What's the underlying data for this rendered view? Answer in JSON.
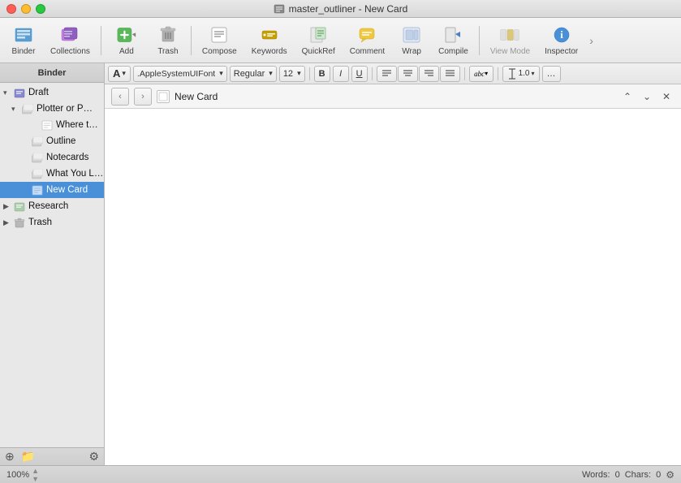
{
  "window": {
    "title": "master_outliner - New Card"
  },
  "titlebar": {
    "buttons": {
      "close": "close",
      "minimize": "minimize",
      "maximize": "maximize"
    }
  },
  "toolbar": {
    "items": [
      {
        "id": "binder",
        "label": "Binder",
        "icon": "binder-icon"
      },
      {
        "id": "collections",
        "label": "Collections",
        "icon": "collections-icon"
      },
      {
        "id": "add",
        "label": "Add",
        "icon": "add-icon",
        "has_arrow": true
      },
      {
        "id": "trash",
        "label": "Trash",
        "icon": "trash-icon"
      },
      {
        "id": "compose",
        "label": "Compose",
        "icon": "compose-icon"
      },
      {
        "id": "keywords",
        "label": "Keywords",
        "icon": "keywords-icon"
      },
      {
        "id": "quickref",
        "label": "QuickRef",
        "icon": "quickref-icon"
      },
      {
        "id": "comment",
        "label": "Comment",
        "icon": "comment-icon"
      },
      {
        "id": "wrap",
        "label": "Wrap",
        "icon": "wrap-icon"
      },
      {
        "id": "compile",
        "label": "Compile",
        "icon": "compile-icon"
      },
      {
        "id": "viewmode",
        "label": "View Mode",
        "icon": "viewmode-icon"
      },
      {
        "id": "inspector",
        "label": "Inspector",
        "icon": "inspector-icon"
      }
    ],
    "chevron": "›"
  },
  "binder": {
    "header": "Binder",
    "tree": [
      {
        "id": "draft",
        "label": "Draft",
        "indent": 0,
        "arrow": "▾",
        "icon": "folder",
        "expanded": true
      },
      {
        "id": "plotter",
        "label": "Plotter or P…",
        "indent": 1,
        "arrow": "▾",
        "icon": "stack",
        "expanded": true
      },
      {
        "id": "where",
        "label": "Where t…",
        "indent": 2,
        "arrow": "",
        "icon": "doc"
      },
      {
        "id": "outline",
        "label": "Outline",
        "indent": 1,
        "arrow": "",
        "icon": "stack"
      },
      {
        "id": "notecards",
        "label": "Notecards",
        "indent": 1,
        "arrow": "",
        "icon": "stack"
      },
      {
        "id": "whatyou",
        "label": "What You L…",
        "indent": 1,
        "arrow": "",
        "icon": "stack"
      },
      {
        "id": "newcard",
        "label": "New Card",
        "indent": 1,
        "arrow": "",
        "icon": "doc",
        "selected": true
      },
      {
        "id": "research",
        "label": "Research",
        "indent": 0,
        "arrow": "▶",
        "icon": "folder"
      },
      {
        "id": "trash",
        "label": "Trash",
        "indent": 0,
        "arrow": "▶",
        "icon": "trash"
      }
    ],
    "footer": {
      "add_group": "+",
      "add_item": "⊕",
      "settings": "⚙"
    }
  },
  "formatbar": {
    "font_size_btn": "A",
    "font_name": ".AppleSystemUIFont",
    "font_style": "Regular",
    "font_size": "12",
    "bold": "B",
    "italic": "I",
    "underline": "U",
    "align_left": "≡",
    "align_center": "≡",
    "align_right": "≡",
    "align_justify": "≡",
    "color_box": "abc",
    "line_height_icon": "↕",
    "line_height": "1.0",
    "more": "…"
  },
  "editor": {
    "title": "New Card",
    "nav_back": "‹",
    "nav_forward": "›",
    "expand_up": "⌃",
    "expand_down": "⌄",
    "close_pane": "✕"
  },
  "statusbar": {
    "zoom": "100%",
    "words_label": "Words:",
    "words_value": "0",
    "chars_label": "Chars:",
    "chars_value": "0",
    "settings_icon": "⚙"
  }
}
